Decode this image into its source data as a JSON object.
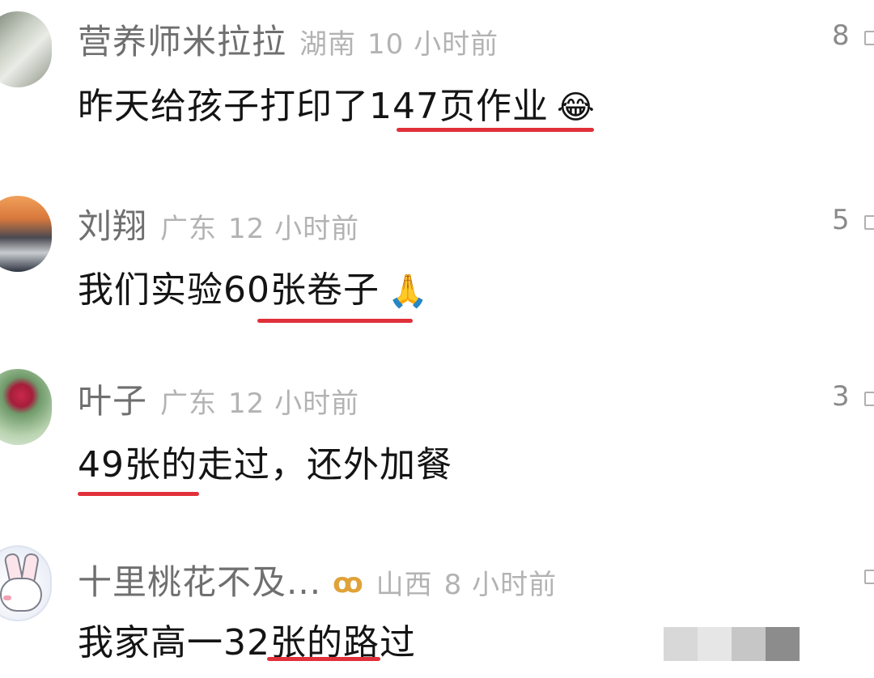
{
  "comments": [
    {
      "name": "营养师米拉拉",
      "region": "湖南",
      "time": "10 小时前",
      "text": "昨天给孩子打印了147页作业",
      "emoji": "😂",
      "likes": "8"
    },
    {
      "name": "刘翔",
      "region": "广东",
      "time": "12 小时前",
      "text": "我们实验60张卷子",
      "emoji": "🙏",
      "likes": "5"
    },
    {
      "name": "叶子",
      "region": "广东",
      "time": "12 小时前",
      "text": "49张的走过，还外加餐",
      "emoji": "",
      "likes": "3"
    },
    {
      "name": "十里桃花不及...",
      "region": "山西",
      "time": "8 小时前",
      "text": "我家高一32张的路过",
      "emoji": "",
      "likes": "",
      "badge_icon": "vip-bow-icon"
    }
  ],
  "colors": {
    "name": "#6f6f6f",
    "meta": "#b3b3b3",
    "text": "#141414",
    "underline": "#e0303a",
    "badge": "#e0a238"
  }
}
